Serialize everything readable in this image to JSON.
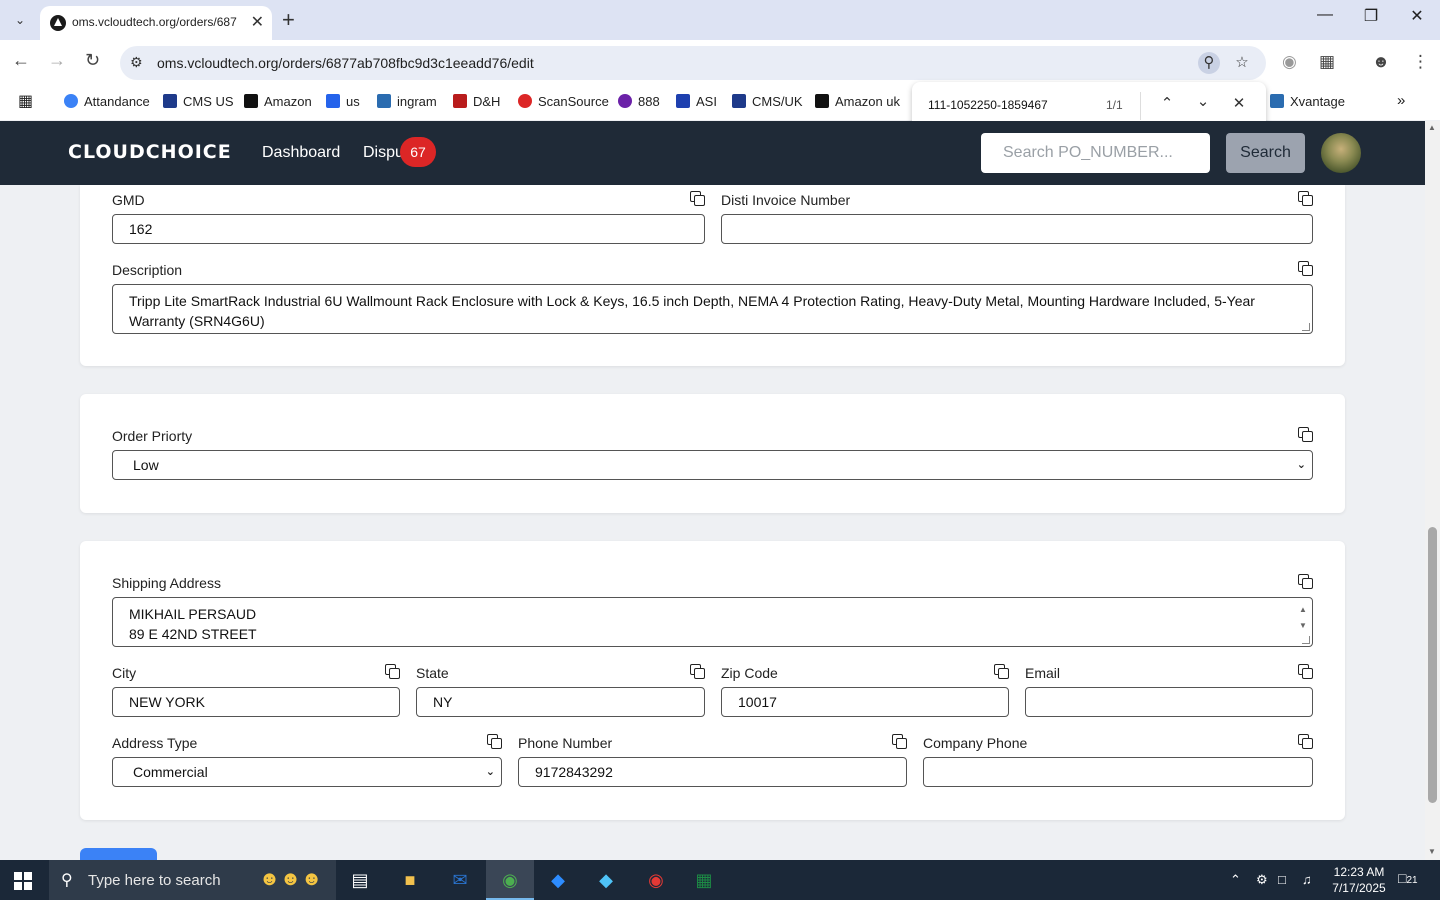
{
  "browser": {
    "tab_title": "oms.vcloudtech.org/orders/687",
    "url": "oms.vcloudtech.org/orders/6877ab708fbc9d3c1eeadd76/edit",
    "bookmarks": [
      "Attandance",
      "CMS US",
      "Amazon",
      "us",
      "ingram",
      "D&H",
      "ScanSource",
      "888",
      "ASI",
      "CMS/UK",
      "Amazon uk",
      "Xvantage"
    ],
    "find": {
      "query": "111-1052250-1859467",
      "count": "1/1"
    }
  },
  "app": {
    "logo": "CLOUDCHOICE",
    "nav": {
      "dashboard": "Dashboard",
      "disputes": "Dispu",
      "disputes_badge": "67"
    },
    "search": {
      "placeholder": "Search PO_NUMBER...",
      "button": "Search"
    }
  },
  "form": {
    "gmd": {
      "label": "GMD",
      "value": "162"
    },
    "disti_invoice": {
      "label": "Disti Invoice Number",
      "value": ""
    },
    "description": {
      "label": "Description",
      "value": "Tripp Lite SmartRack Industrial 6U Wallmount Rack Enclosure with Lock & Keys, 16.5 inch Depth, NEMA 4 Protection Rating, Heavy-Duty Metal, Mounting Hardware Included, 5-Year Warranty (SRN4G6U)"
    },
    "order_priority": {
      "label": "Order Priorty",
      "value": "Low"
    },
    "shipping_address": {
      "label": "Shipping Address",
      "line1": "MIKHAIL PERSAUD",
      "line2": "89 E 42ND STREET"
    },
    "city": {
      "label": "City",
      "value": "NEW YORK"
    },
    "state": {
      "label": "State",
      "value": "NY"
    },
    "zip": {
      "label": "Zip Code",
      "value": "10017"
    },
    "email": {
      "label": "Email",
      "value": ""
    },
    "address_type": {
      "label": "Address Type",
      "value": "Commercial"
    },
    "phone": {
      "label": "Phone Number",
      "value": "9172843292"
    },
    "company_phone": {
      "label": "Company Phone",
      "value": ""
    }
  },
  "taskbar": {
    "search_placeholder": "Type here to search",
    "time": "12:23 AM",
    "date": "7/17/2025",
    "notifications": "21"
  }
}
